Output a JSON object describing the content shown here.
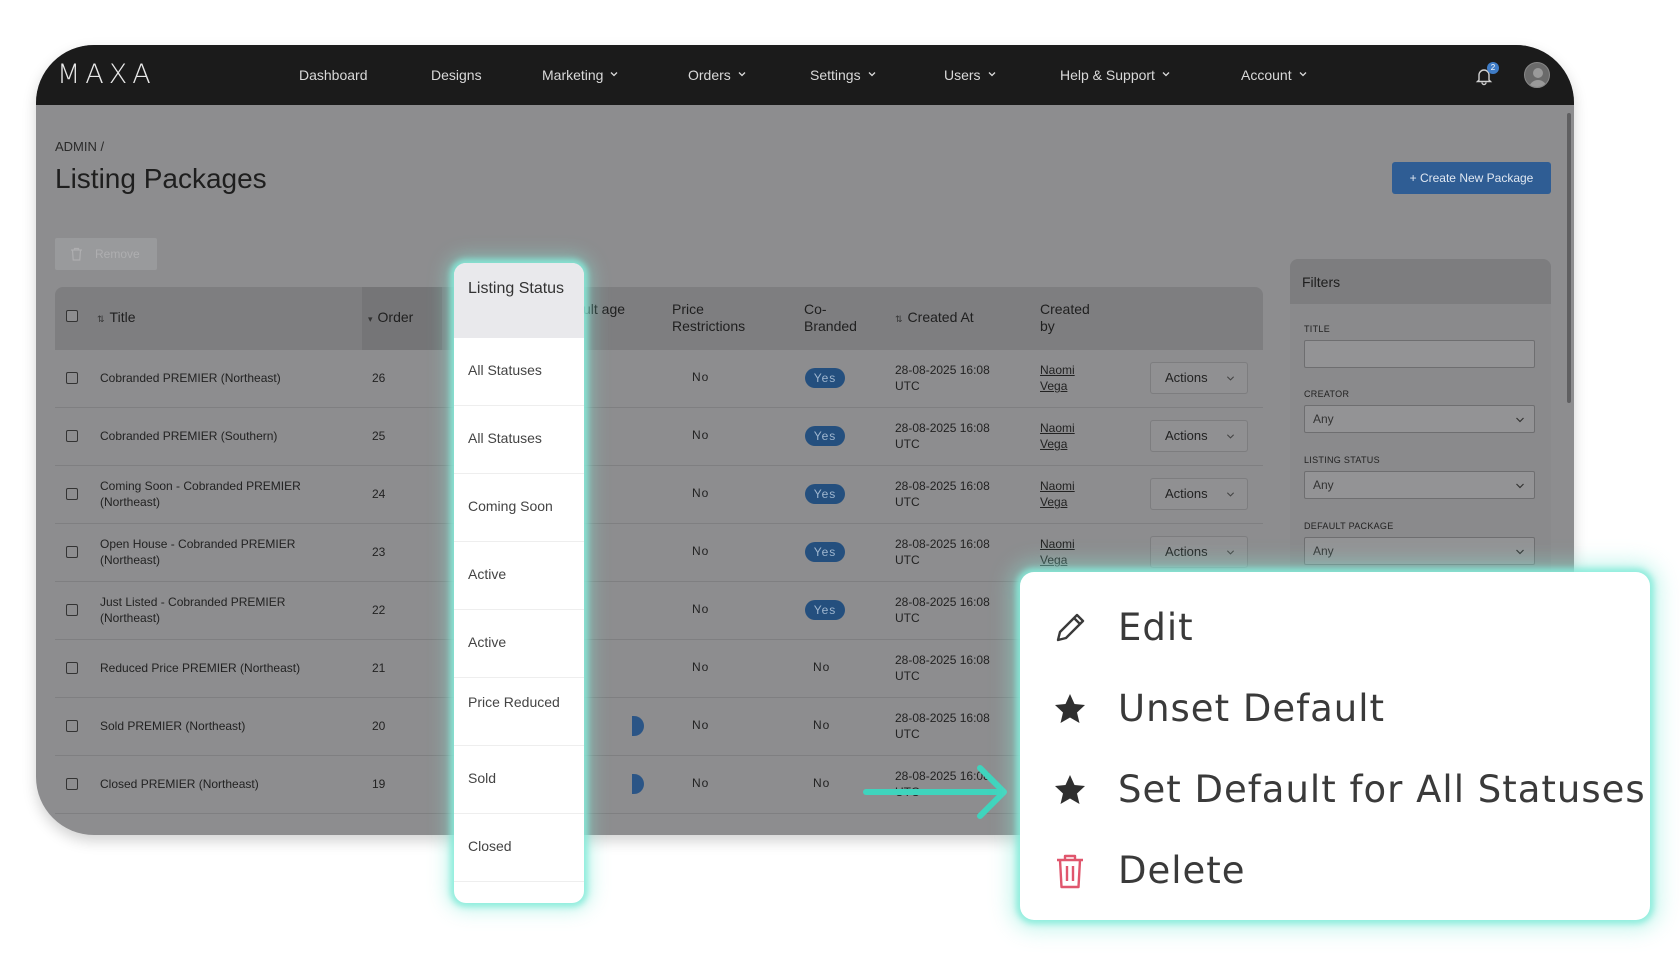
{
  "app": {
    "logo": "MAXA",
    "nav": [
      "Dashboard",
      "Designs",
      "Marketing",
      "Orders",
      "Settings",
      "Users",
      "Help & Support",
      "Account"
    ],
    "notification_count": "2"
  },
  "page": {
    "breadcrumb": "ADMIN /",
    "title": "Listing Packages",
    "create_button": "+ Create New Package",
    "remove_button": "Remove"
  },
  "table": {
    "headers": {
      "title": "Title",
      "order": "Order",
      "default_package": "ult age",
      "price_restrictions": "Price Restrictions",
      "co_branded": "Co- Branded",
      "created_at": "Created At",
      "created_by": "Created by"
    },
    "rows": [
      {
        "title": "Cobranded PREMIER (Northeast)",
        "order": "26",
        "price": "No",
        "co": "Yes",
        "created_at": "28-08-2025 16:08 UTC",
        "creator": "Naomi Vega",
        "action": "Actions"
      },
      {
        "title": "Cobranded PREMIER (Southern)",
        "order": "25",
        "price": "No",
        "co": "Yes",
        "created_at": "28-08-2025 16:08 UTC",
        "creator": "Naomi Vega",
        "action": "Actions"
      },
      {
        "title": "Coming Soon - Cobranded PREMIER (Northeast)",
        "order": "24",
        "price": "No",
        "co": "Yes",
        "created_at": "28-08-2025 16:08 UTC",
        "creator": "Naomi Vega",
        "action": "Actions"
      },
      {
        "title": "Open House - Cobranded PREMIER (Northeast)",
        "order": "23",
        "price": "No",
        "co": "Yes",
        "created_at": "28-08-2025 16:08 UTC",
        "creator": "Naomi Vega",
        "action": "Actions"
      },
      {
        "title": "Just Listed - Cobranded PREMIER (Northeast)",
        "order": "22",
        "price": "No",
        "co": "Yes",
        "created_at": "28-08-2025 16:08 UTC",
        "creator": "",
        "action": ""
      },
      {
        "title": "Reduced Price PREMIER (Northeast)",
        "order": "21",
        "price": "No",
        "co": "No",
        "created_at": "28-08-2025 16:08 UTC",
        "creator": "",
        "action": ""
      },
      {
        "title": "Sold PREMIER (Northeast)",
        "order": "20",
        "price": "No",
        "co": "No",
        "created_at": "28-08-2025 16:08 UTC",
        "creator": "",
        "action": ""
      },
      {
        "title": "Closed PREMIER (Northeast)",
        "order": "19",
        "price": "No",
        "co": "No",
        "created_at": "28-08-2025 16:08 UTC",
        "creator": "",
        "action": ""
      }
    ]
  },
  "filters": {
    "title": "Filters",
    "title_label": "TITLE",
    "creator_label": "CREATOR",
    "creator_value": "Any",
    "status_label": "LISTING STATUS",
    "status_value": "Any",
    "default_label": "DEFAULT PACKAGE",
    "default_value": "Any"
  },
  "status_column": {
    "header": "Listing Status",
    "values": [
      "All Statuses",
      "All Statuses",
      "Coming Soon",
      "Active",
      "Active",
      "Price Reduced",
      "Sold",
      "Closed"
    ]
  },
  "actions_menu": {
    "items": [
      {
        "label": "Edit",
        "icon": "pencil-icon"
      },
      {
        "label": "Unset Default",
        "icon": "star-icon"
      },
      {
        "label": "Set Default for All Statuses",
        "icon": "star-icon"
      },
      {
        "label": "Delete",
        "icon": "trash-icon"
      }
    ],
    "accent_color": "#3fd4bd",
    "delete_color": "#e0566d"
  }
}
